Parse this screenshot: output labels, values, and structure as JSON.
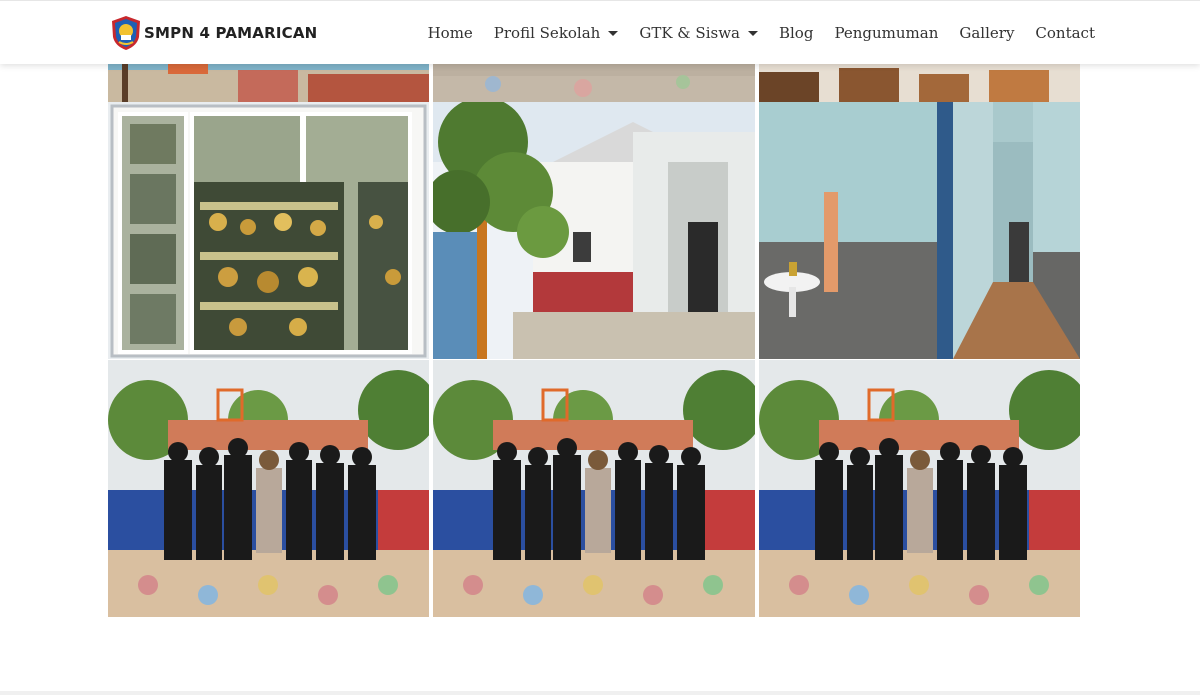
{
  "brand": {
    "name": "SMPN 4 PAMARICAN",
    "logo_icon": "school-shield-logo"
  },
  "nav": {
    "items": [
      {
        "label": "Home",
        "dropdown": false
      },
      {
        "label": "Profil Sekolah",
        "dropdown": true
      },
      {
        "label": "GTK & Siswa",
        "dropdown": true
      },
      {
        "label": "Blog",
        "dropdown": false
      },
      {
        "label": "Pengumuman",
        "dropdown": false
      },
      {
        "label": "Gallery",
        "dropdown": false
      },
      {
        "label": "Contact",
        "dropdown": false
      }
    ]
  },
  "gallery": {
    "photos": [
      {
        "subject": "schoolyard-ground"
      },
      {
        "subject": "painted-pavement"
      },
      {
        "subject": "classroom-desks"
      },
      {
        "subject": "trophy-cabinet"
      },
      {
        "subject": "school-building-corner"
      },
      {
        "subject": "corridor-with-sink"
      },
      {
        "subject": "students-group-photo"
      },
      {
        "subject": "students-group-photo"
      },
      {
        "subject": "students-group-photo"
      }
    ]
  },
  "colors": {
    "nav_text": "#333333",
    "brand_text": "#222222",
    "page_bg": "#ffffff"
  }
}
